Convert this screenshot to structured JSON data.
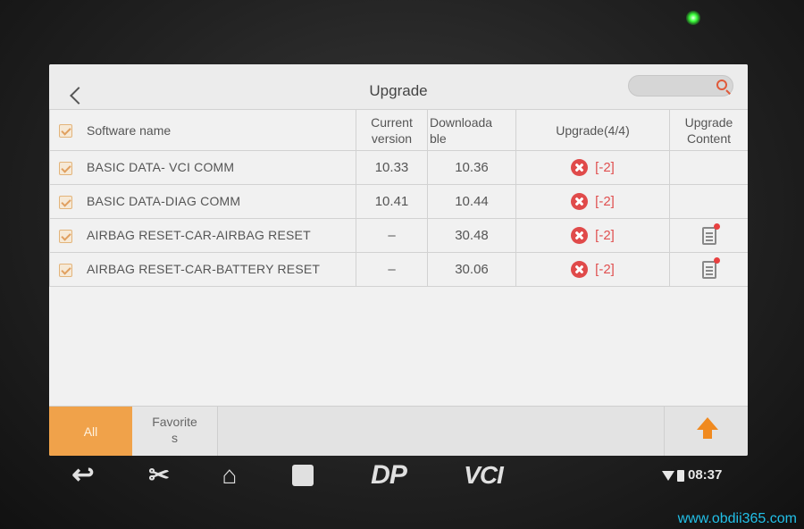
{
  "header": {
    "title": "Upgrade",
    "search_placeholder": ""
  },
  "table": {
    "columns": {
      "name": "Software name",
      "current_l1": "Current",
      "current_l2": "version",
      "down_l1": "Downloada",
      "down_l2": "ble",
      "upgrade": "Upgrade(4/4)",
      "content_l1": "Upgrade",
      "content_l2": "Content"
    },
    "rows": [
      {
        "name": "BASIC DATA- VCI COMM",
        "current": "10.33",
        "downloadable": "10.36",
        "status": "[-2]"
      },
      {
        "name": "BASIC DATA-DIAG COMM",
        "current": "10.41",
        "downloadable": "10.44",
        "status": "[-2]"
      },
      {
        "name": "AIRBAG RESET-CAR-AIRBAG RESET",
        "current": "–",
        "downloadable": "30.48",
        "status": "[-2]"
      },
      {
        "name": "AIRBAG RESET-CAR-BATTERY RESET",
        "current": "–",
        "downloadable": "30.06",
        "status": "[-2]"
      }
    ]
  },
  "bottom": {
    "tab_all": "All",
    "tab_fav_l1": "Favorite",
    "tab_fav_l2": "s"
  },
  "navbar": {
    "back": "↩",
    "cut": "✂",
    "home": "⌂",
    "dp": "DP",
    "vci": "VCI",
    "time": "08:37"
  },
  "watermark": "www.obdii365.com",
  "colors": {
    "accent": "#f0a24a",
    "error": "#e04a4a",
    "upload": "#f08a20",
    "watermark": "#22c0e8"
  }
}
